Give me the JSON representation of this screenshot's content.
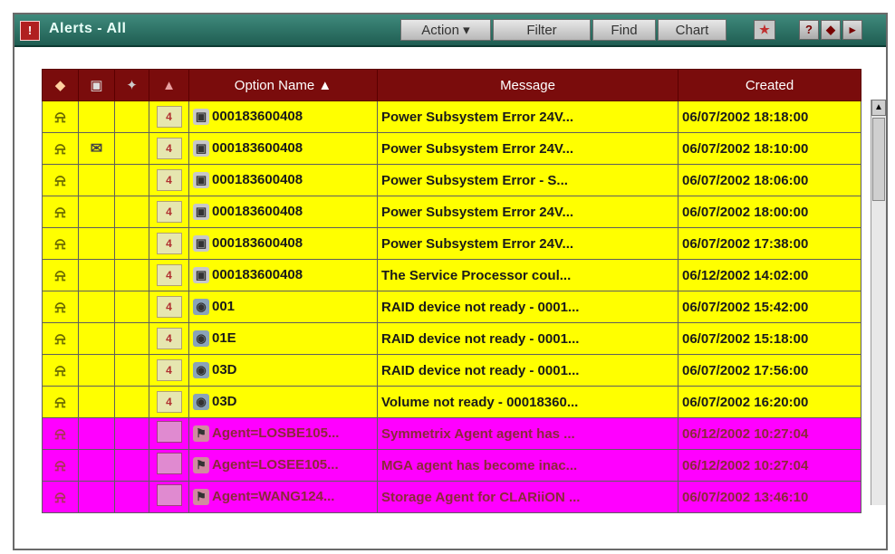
{
  "window": {
    "title": "Alerts - All",
    "title_icon_glyph": "!"
  },
  "toolbar": {
    "action_label": "Action ▾",
    "filter_label": "Filter",
    "find_label": "Find",
    "chart_label": "Chart",
    "star_icon_glyph": "★",
    "help_glyph": "?",
    "nav_glyph": "◆",
    "side_glyph": "▸"
  },
  "table": {
    "columns": {
      "severity_icon": "severity-bell-icon",
      "ack_icon": "note-icon",
      "tool_icon": "tool-icon",
      "level_icon": "level-icon",
      "option_name": "Option Name ▲",
      "message": "Message",
      "created": "Created"
    },
    "rows": [
      {
        "color": "#ffff00",
        "note": "",
        "level": "4",
        "obj": "dev",
        "name": "000183600408",
        "message": "Power Subsystem Error 24V...",
        "created": "06/07/2002 18:18:00"
      },
      {
        "color": "#ffff00",
        "note": "✉",
        "level": "4",
        "obj": "dev",
        "name": "000183600408",
        "message": "Power Subsystem Error 24V...",
        "created": "06/07/2002 18:10:00"
      },
      {
        "color": "#ffff00",
        "note": "",
        "level": "4",
        "obj": "dev",
        "name": "000183600408",
        "message": "Power Subsystem Error   - S...",
        "created": "06/07/2002 18:06:00"
      },
      {
        "color": "#ffff00",
        "note": "",
        "level": "4",
        "obj": "dev",
        "name": "000183600408",
        "message": "Power Subsystem Error 24V...",
        "created": "06/07/2002 18:00:00"
      },
      {
        "color": "#ffff00",
        "note": "",
        "level": "4",
        "obj": "dev",
        "name": "000183600408",
        "message": "Power Subsystem Error 24V...",
        "created": "06/07/2002 17:38:00"
      },
      {
        "color": "#ffff00",
        "note": "",
        "level": "4",
        "obj": "dev",
        "name": "000183600408",
        "message": "The Service Processor coul...",
        "created": "06/12/2002 14:02:00"
      },
      {
        "color": "#ffff00",
        "note": "",
        "level": "4",
        "obj": "raid",
        "name": "001",
        "message": "RAID device not ready - 0001...",
        "created": "06/07/2002 15:42:00"
      },
      {
        "color": "#ffff00",
        "note": "",
        "level": "4",
        "obj": "raid",
        "name": "01E",
        "message": "RAID device not ready - 0001...",
        "created": "06/07/2002 15:18:00"
      },
      {
        "color": "#ffff00",
        "note": "",
        "level": "4",
        "obj": "raid",
        "name": "03D",
        "message": "RAID device not ready - 0001...",
        "created": "06/07/2002 17:56:00"
      },
      {
        "color": "#ffff00",
        "note": "",
        "level": "4",
        "obj": "raid",
        "name": "03D",
        "message": "Volume not ready - 00018360...",
        "created": "06/07/2002 16:20:00"
      },
      {
        "color": "#ff00ff",
        "note": "",
        "level": "",
        "obj": "agent",
        "name": "Agent=LOSBE105...",
        "message": "Symmetrix Agent agent has ...",
        "created": "06/12/2002 10:27:04"
      },
      {
        "color": "#ff00ff",
        "note": "",
        "level": "",
        "obj": "agent",
        "name": "Agent=LOSEE105...",
        "message": "MGA agent has become inac...",
        "created": "06/12/2002 10:27:04"
      },
      {
        "color": "#ff00ff",
        "note": "",
        "level": "",
        "obj": "agent",
        "name": "Agent=WANG124...",
        "message": "Storage Agent for CLARiiON ...",
        "created": "06/07/2002 13:46:10"
      }
    ]
  },
  "glyphs": {
    "bell": "⍾",
    "dev": "▣",
    "raid": "◉",
    "agent": "⚑"
  }
}
